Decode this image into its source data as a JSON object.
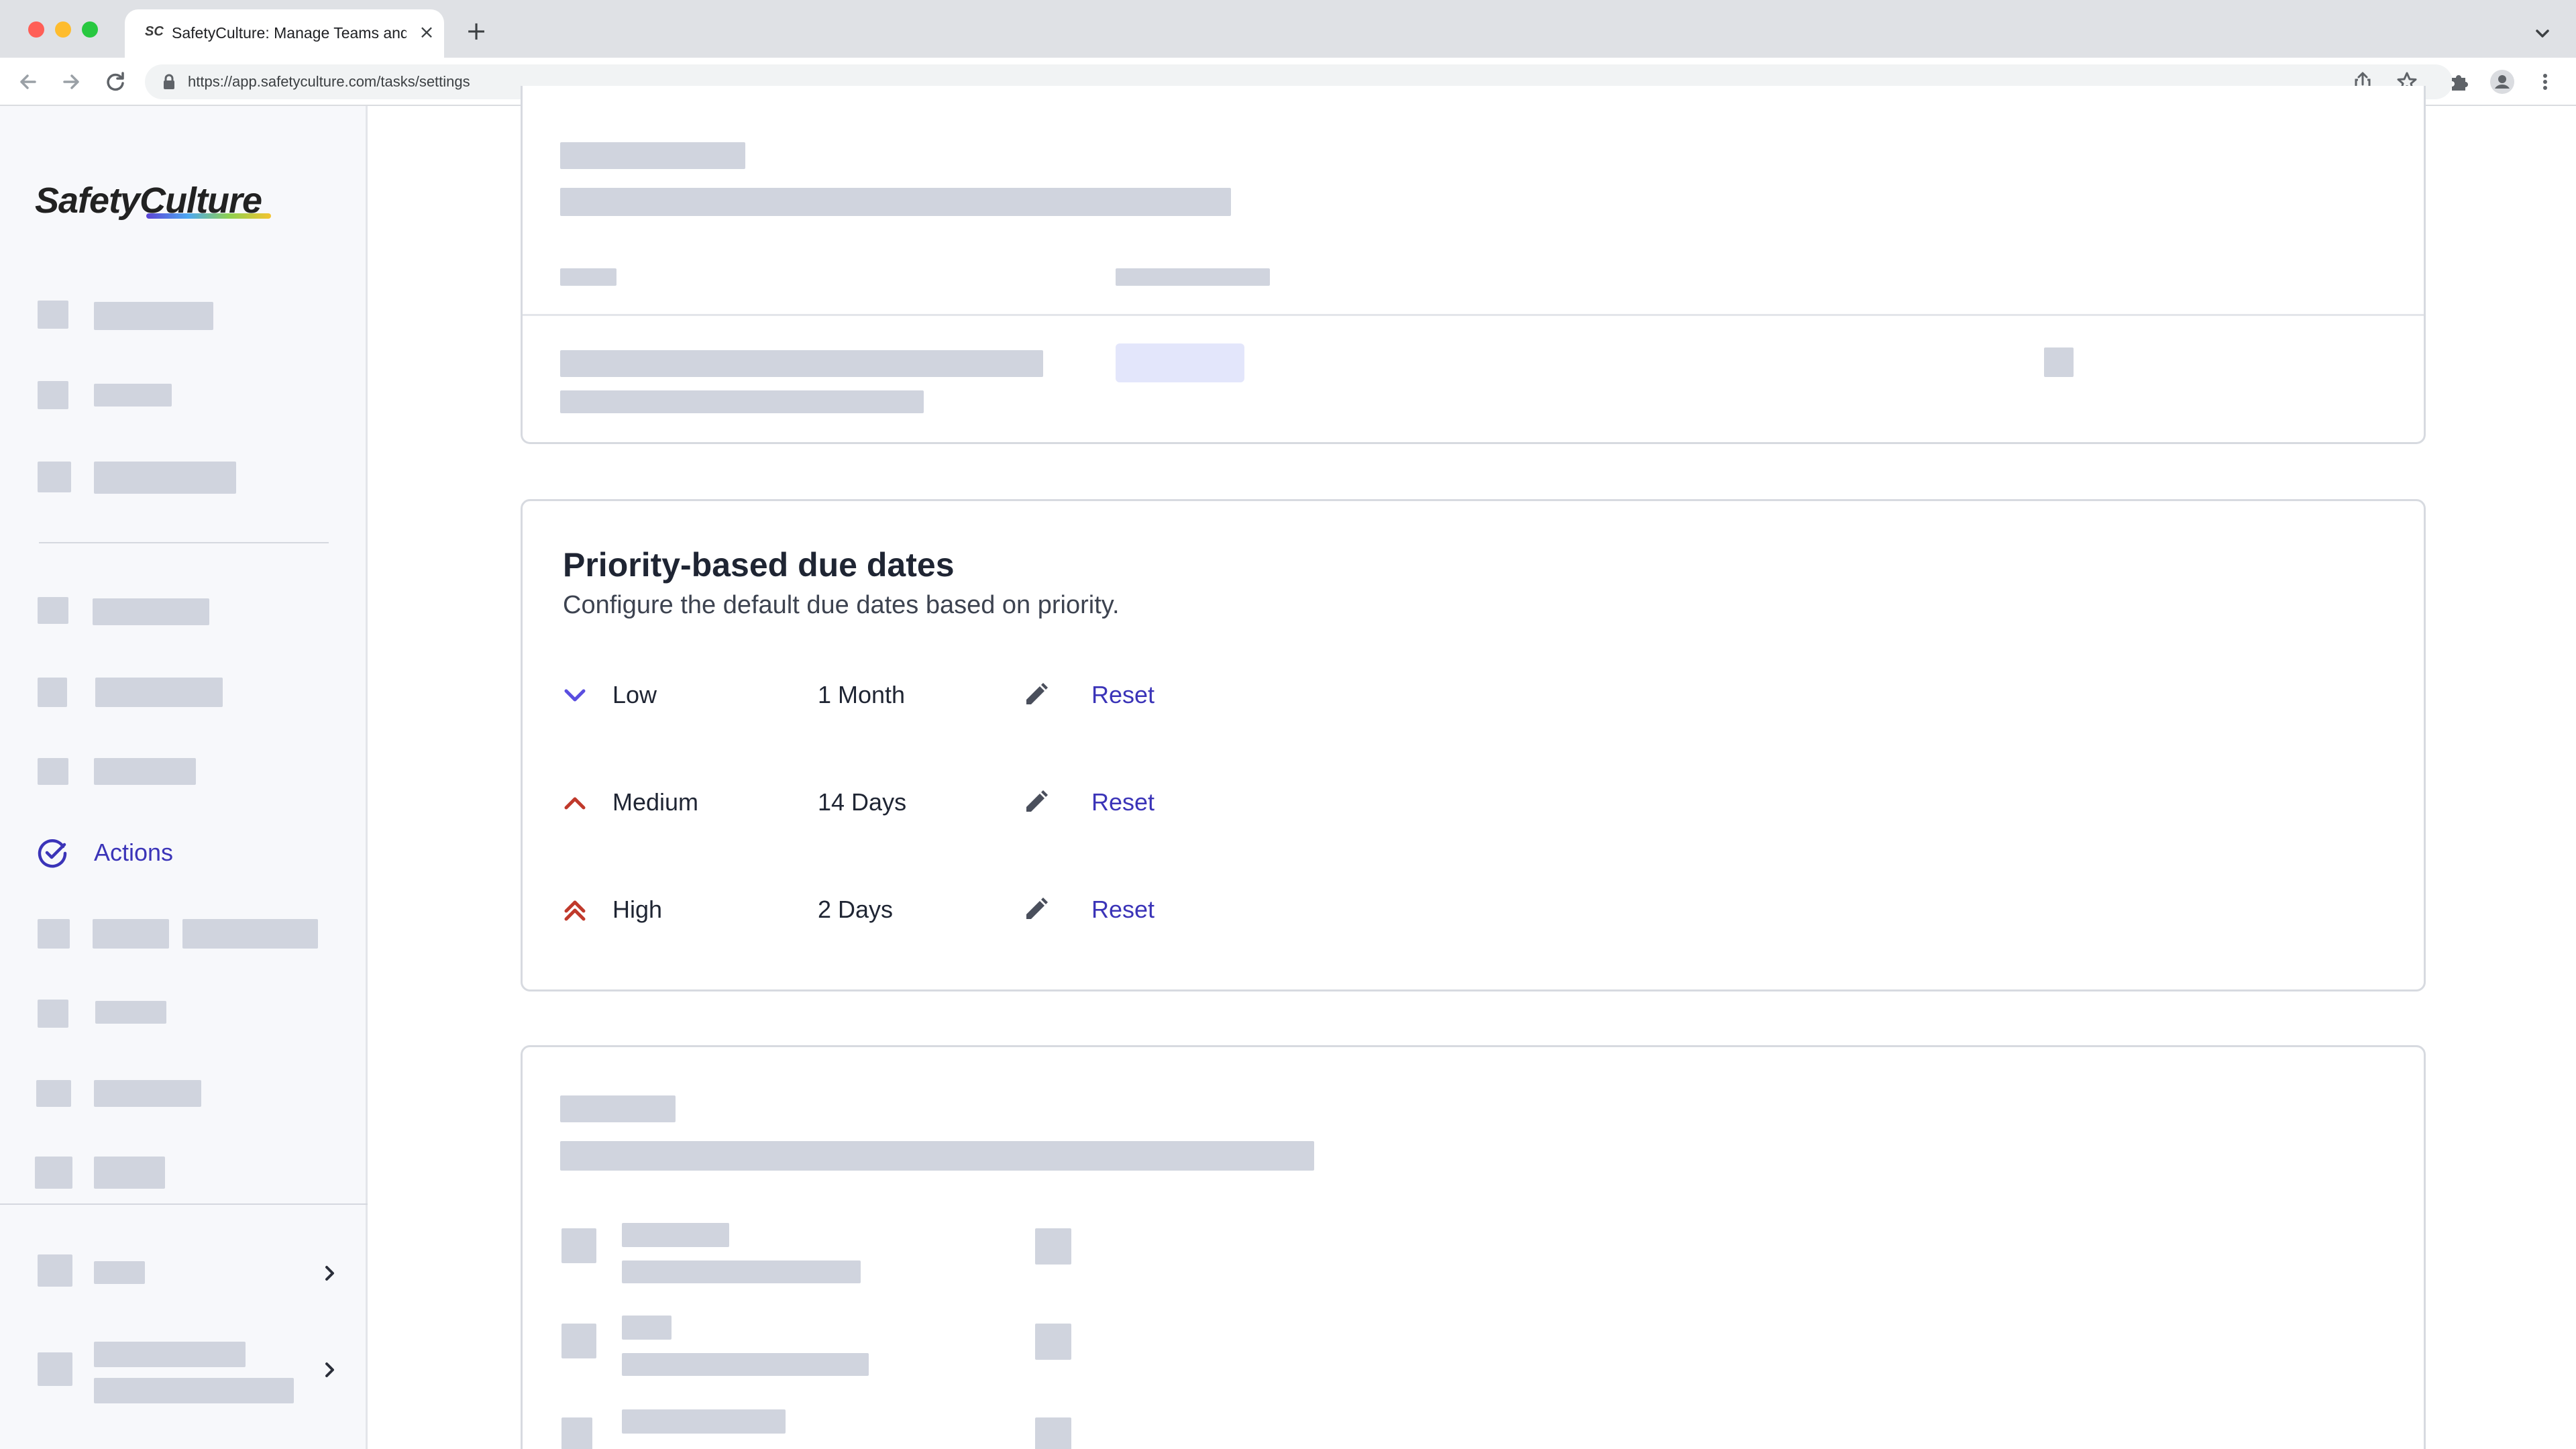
{
  "browser": {
    "tab_title": "SafetyCulture: Manage Teams and ...",
    "tab_favicon_text": "SC",
    "url": "https://app.safetyculture.com/tasks/settings",
    "close_glyph": "×",
    "new_tab_glyph": "+"
  },
  "sidebar": {
    "logo": "SafetyCulture",
    "active_item": {
      "label": "Actions",
      "icon": "check-circle-icon",
      "color": "#3b34b8"
    }
  },
  "priority_card": {
    "title": "Priority-based due dates",
    "description": "Configure the default due dates based on priority.",
    "rows": [
      {
        "priority": "Low",
        "icon": "chevron-down-icon",
        "icon_color": "#5a4ee0",
        "due": "1 Month",
        "reset_label": "Reset"
      },
      {
        "priority": "Medium",
        "icon": "chevron-up-icon",
        "icon_color": "#c0392b",
        "due": "14 Days",
        "reset_label": "Reset"
      },
      {
        "priority": "High",
        "icon": "double-chevron-up-icon",
        "icon_color": "#c0392b",
        "due": "2 Days",
        "reset_label": "Reset"
      }
    ]
  },
  "colors": {
    "accent": "#3b34b8",
    "skeleton": "#d0d4de",
    "skeleton_highlight": "#e3e6fb",
    "card_border": "#d7dae0"
  }
}
